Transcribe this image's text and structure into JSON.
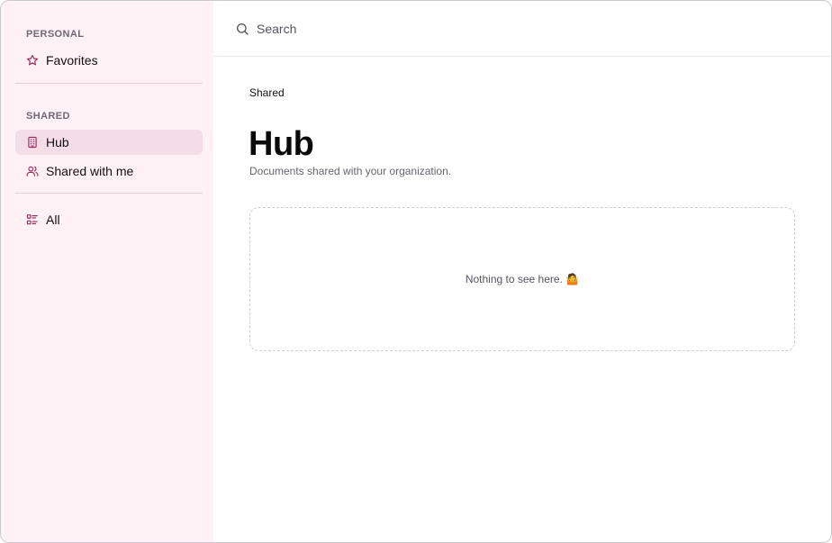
{
  "sidebar": {
    "personal_label": "PERSONAL",
    "shared_label": "SHARED",
    "items": {
      "favorites": {
        "label": "Favorites",
        "icon": "star-icon"
      },
      "hub": {
        "label": "Hub",
        "icon": "building-icon"
      },
      "shared_with_me": {
        "label": "Shared with me",
        "icon": "users-icon"
      },
      "all": {
        "label": "All",
        "icon": "list-icon"
      }
    },
    "accent_color": "#9b2c5e",
    "background_color": "#fff1f6",
    "active_color": "#f5dde8"
  },
  "search": {
    "placeholder": "Search",
    "icon": "search-icon"
  },
  "main": {
    "breadcrumb": "Shared",
    "title": "Hub",
    "subtitle": "Documents shared with your organization.",
    "empty_message": "Nothing to see here. 🤷"
  }
}
